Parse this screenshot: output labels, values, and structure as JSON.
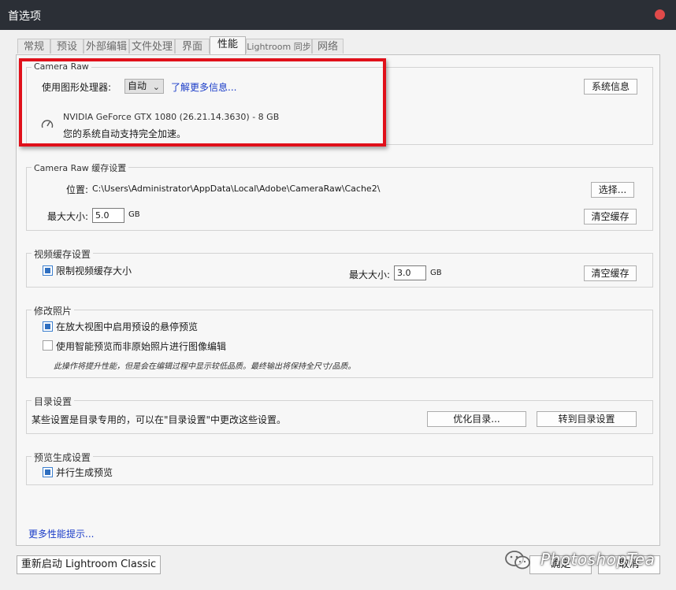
{
  "window": {
    "title": "首选项"
  },
  "tabs": [
    "常规",
    "预设",
    "外部编辑",
    "文件处理",
    "界面",
    "性能",
    "Lightroom 同步",
    "网络"
  ],
  "active_tab": "性能",
  "camera_raw": {
    "title": "Camera Raw",
    "gpu_label": "使用图形处理器:",
    "gpu_value": "自动",
    "learn_more": "了解更多信息...",
    "system_info": "系统信息",
    "gpu_name": "NVIDIA GeForce GTX 1080 (26.21.14.3630) - 8 GB",
    "gpu_status": "您的系统自动支持完全加速。"
  },
  "cache": {
    "title": "Camera Raw 缓存设置",
    "location_label": "位置:",
    "location_value": "C:\\Users\\Administrator\\AppData\\Local\\Adobe\\CameraRaw\\Cache2\\",
    "choose_button": "选择...",
    "max_size_label": "最大大小:",
    "max_size_value": "5.0",
    "unit": "GB",
    "clear_button": "清空缓存"
  },
  "video_cache": {
    "title": "视频缓存设置",
    "limit_label": "限制视频缓存大小",
    "max_size_label": "最大大小:",
    "max_size_value": "3.0",
    "unit": "GB",
    "clear_button": "清空缓存"
  },
  "develop": {
    "title": "修改照片",
    "option1": "在放大视图中启用预设的悬停预览",
    "option2": "使用智能预览而非原始照片进行图像编辑",
    "note": "此操作将提升性能，但是会在编辑过程中显示较低品质。最终输出将保持全尺寸/品质。"
  },
  "catalog": {
    "title": "目录设置",
    "description": "某些设置是目录专用的，可以在\"目录设置\"中更改这些设置。",
    "optimize_button": "优化目录...",
    "goto_button": "转到目录设置"
  },
  "preview": {
    "title": "预览生成设置",
    "parallel_label": "并行生成预览"
  },
  "more_tips": "更多性能提示...",
  "bottom": {
    "restart_button": "重新启动 Lightroom Classic",
    "ok_button": "确定",
    "cancel_button": "取消"
  },
  "watermark": {
    "text": "PhotoshopTea"
  },
  "colors": {
    "title_bar": "#2b2f36",
    "link": "#1a3cc8",
    "highlight_box": "#e0101a",
    "checkbox": "#2f6fc0"
  }
}
